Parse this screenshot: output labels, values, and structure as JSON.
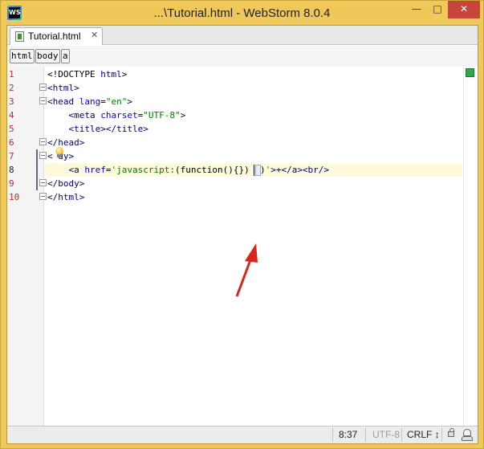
{
  "window": {
    "title": "...\\Tutorial.html - WebStorm 8.0.4",
    "logo_icon": "webstorm-logo-icon",
    "controls": {
      "minimize": "—",
      "maximize": "□",
      "close": "✕"
    }
  },
  "editor_tabs": [
    {
      "label": "Tutorial.html",
      "icon": "html-file-icon",
      "close_glyph": "✕"
    }
  ],
  "breadcrumbs": [
    "html",
    "body",
    "a"
  ],
  "gutter": {
    "line_numbers": [
      "1",
      "2",
      "3",
      "4",
      "5",
      "6",
      "7",
      "8",
      "9",
      "10"
    ],
    "current_line": "8"
  },
  "code": {
    "lines": [
      {
        "parts": [
          [
            "plain",
            "<!DOCTYPE "
          ],
          [
            "tag",
            "html"
          ],
          [
            "plain",
            ">"
          ]
        ]
      },
      {
        "parts": [
          [
            "tag",
            "<html>"
          ]
        ]
      },
      {
        "parts": [
          [
            "tag",
            "<head "
          ],
          [
            "attr",
            "lang"
          ],
          [
            "plain",
            "="
          ],
          [
            "val",
            "\"en\""
          ],
          [
            "tag",
            ">"
          ]
        ]
      },
      {
        "parts": [
          [
            "plain",
            "    "
          ],
          [
            "tag",
            "<meta "
          ],
          [
            "attr",
            "charset"
          ],
          [
            "plain",
            "="
          ],
          [
            "val",
            "\"UTF-8\""
          ],
          [
            "tag",
            ">"
          ]
        ]
      },
      {
        "parts": [
          [
            "plain",
            "    "
          ],
          [
            "tag",
            "<title></title>"
          ]
        ]
      },
      {
        "parts": [
          [
            "tag",
            "</head>"
          ]
        ]
      },
      {
        "parts": [
          [
            "tag",
            "<"
          ],
          [
            "plain",
            " "
          ],
          [
            "tag",
            "dy>"
          ]
        ]
      },
      {
        "parts": [
          [
            "plain",
            "    "
          ],
          [
            "tag",
            "<a "
          ],
          [
            "attr",
            "href"
          ],
          [
            "plain",
            "="
          ],
          [
            "val",
            "'javascript:"
          ],
          [
            "plain",
            "(function(){}) ()"
          ],
          [
            "val",
            "'"
          ],
          [
            "tag",
            ">+</a><br/>"
          ]
        ]
      },
      {
        "parts": [
          [
            "tag",
            "</body>"
          ]
        ]
      },
      {
        "parts": [
          [
            "tag",
            "</html>"
          ]
        ]
      }
    ]
  },
  "indicators": {
    "intention_bulb_icon": "lightbulb-icon",
    "inspection_status": "green"
  },
  "status_bar": {
    "position": "8:37",
    "encoding": "UTF-8",
    "line_separator": "CRLF ↕",
    "lock_icon": "lock-icon",
    "inspector_icon": "hector-inspector-icon"
  },
  "colors": {
    "title_bar": "#f0c85a",
    "close_button": "#c7453b",
    "tag": "#000080",
    "attribute": "#0000ff",
    "string_value": "#008000",
    "caret_row": "#fdfbdc",
    "line_numbers": "#aa3333",
    "annotation_arrow": "#d9261c"
  }
}
